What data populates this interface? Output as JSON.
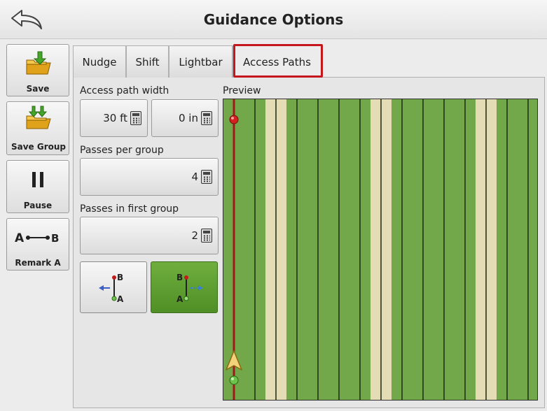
{
  "header": {
    "title": "Guidance Options"
  },
  "actions": [
    {
      "label": "Save"
    },
    {
      "label": "Save Group"
    },
    {
      "label": "Pause"
    },
    {
      "label": "Remark A"
    }
  ],
  "tabs": [
    {
      "label": "Nudge"
    },
    {
      "label": "Shift"
    },
    {
      "label": "Lightbar"
    },
    {
      "label": "Access Paths",
      "active": true
    }
  ],
  "fields": {
    "access_path_width_label": "Access path width",
    "width_ft": "30 ft",
    "width_in": "0 in",
    "passes_per_group_label": "Passes per group",
    "passes_per_group": "4",
    "passes_first_group_label": "Passes in first group",
    "passes_first_group": "2"
  },
  "direction": {
    "left_selected": false,
    "right_selected": true
  },
  "preview": {
    "label": "Preview",
    "colors": {
      "field": "#72a84a",
      "access_path": "#e3dcb5",
      "guidance_line": "#a01818"
    }
  }
}
